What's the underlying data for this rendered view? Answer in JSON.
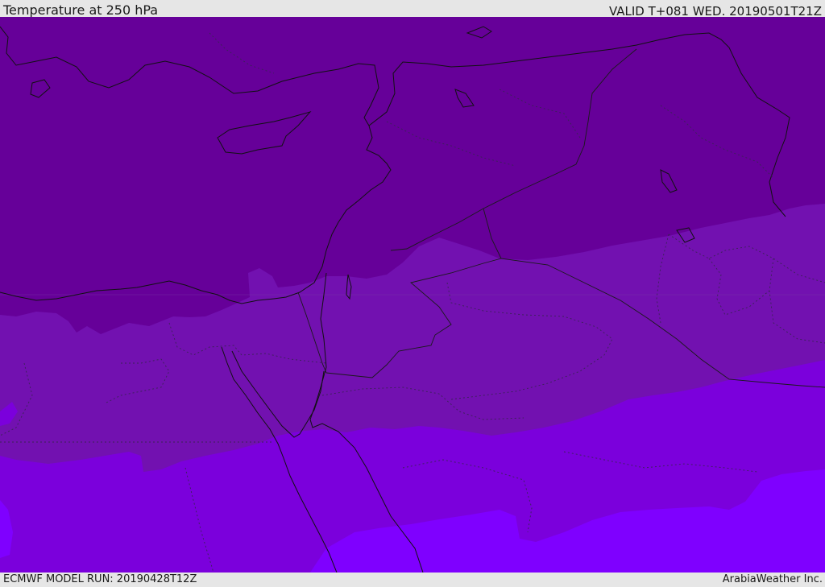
{
  "header": {
    "title": "Temperature at 250 hPa",
    "valid": "VALID T+081 WED. 20190501T21Z"
  },
  "footer": {
    "model_run": "ECMWF MODEL RUN: 20190428T12Z",
    "credit": "ArabiaWeather Inc."
  },
  "map": {
    "field": "temperature-250hPa",
    "colors": {
      "band_coldest": "#660099",
      "band_cool": "#7211b0",
      "band_mid": "#7b00dc",
      "band_warm": "#7f00ff",
      "coastline": "#111111",
      "borders": "#3a2355"
    }
  }
}
